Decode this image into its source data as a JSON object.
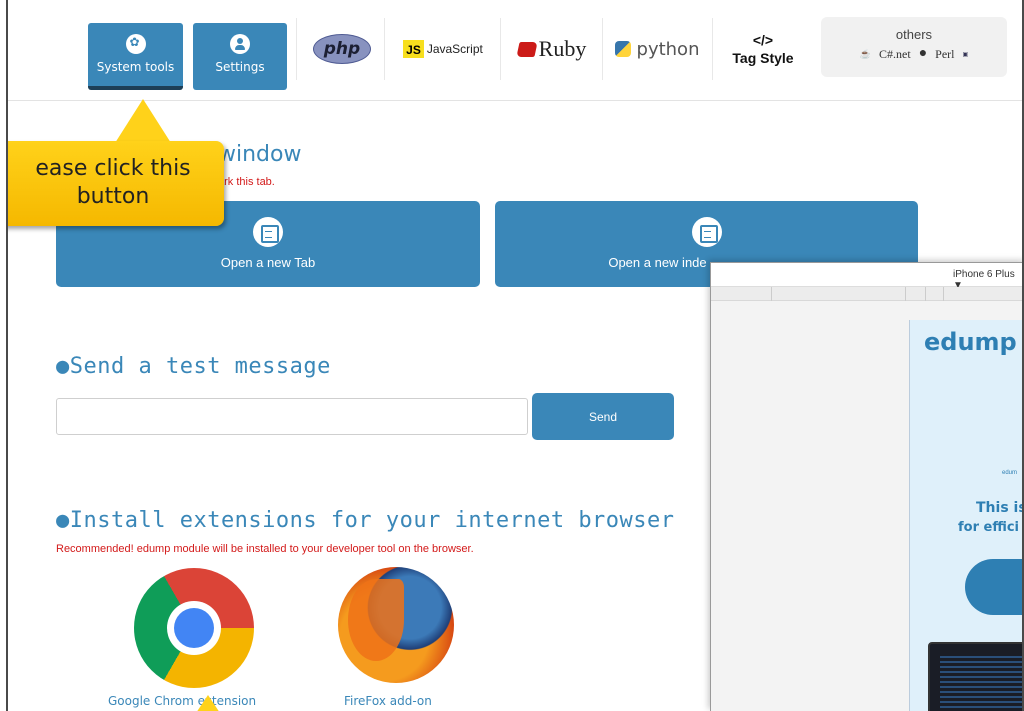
{
  "toolbar": {
    "system_tools_label": "System tools",
    "settings_label": "Settings",
    "php_label": "php",
    "js_badge": "JS",
    "js_label": "JavaScript",
    "ruby_label": "Ruby",
    "python_label": "python",
    "tag_symbol": "</>",
    "tag_label": "Tag Style",
    "others_label": "others",
    "others_items": [
      "C#.net",
      "Perl"
    ]
  },
  "callout": {
    "line1": "ease click this",
    "line2": "button"
  },
  "window_section": {
    "heading": "window",
    "note": "ark this tab.",
    "open_tab_label": "Open a new Tab",
    "open_window_label": "Open a new inde"
  },
  "message_section": {
    "heading": "●Send a test message",
    "input_value": "",
    "send_label": "Send"
  },
  "extensions_section": {
    "heading": "●Install extensions for your internet browser",
    "note": "Recommended! edump module will be installed to your developer tool on the browser.",
    "chrome_label": "Google Chrom  extension",
    "firefox_label": "FireFox add-on"
  },
  "phone_preview": {
    "device_label": "iPhone 6 Plus ▼",
    "brand": "edump",
    "small_text": "edum",
    "line1": "This is",
    "line2": "for effici"
  },
  "colors": {
    "accent": "#3a87b8",
    "callout": "#ffd21a",
    "note_red": "#d31a1a"
  }
}
